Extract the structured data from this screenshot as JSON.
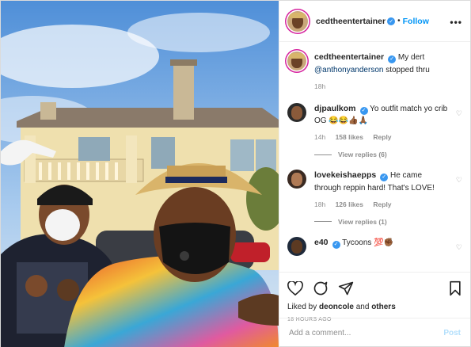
{
  "header": {
    "username": "cedtheentertainer",
    "separator": "•",
    "follow_label": "Follow",
    "more_label": "•••"
  },
  "caption": {
    "username": "cedtheentertainer",
    "text_before": "My dert",
    "mention": "@anthonyanderson",
    "text_after": "stopped thru",
    "time": "18h"
  },
  "comments": [
    {
      "username": "djpaulkom",
      "text": "Yo outfit match yo crib OG 😂😂👍🏾🙏🏾",
      "time": "14h",
      "likes": "158 likes",
      "reply_label": "Reply",
      "view_replies": "View replies (6)"
    },
    {
      "username": "lovekeishaepps",
      "text": "He came through reppin hard! That's LOVE!",
      "time": "18h",
      "likes": "126 likes",
      "reply_label": "Reply",
      "view_replies": "View replies (1)"
    },
    {
      "username": "e40",
      "text": "Tycoons 💯✊🏾",
      "time": "",
      "likes": "",
      "reply_label": "",
      "view_replies": ""
    }
  ],
  "actions": {
    "liked_prefix": "Liked by",
    "liked_user": "deoncole",
    "liked_and": "and",
    "liked_others": "others",
    "timestamp": "18 HOURS AGO"
  },
  "add_comment": {
    "placeholder": "Add a comment...",
    "post_label": "Post"
  },
  "icons": {
    "like": "heart-icon",
    "comment": "comment-icon",
    "share": "share-icon",
    "save": "bookmark-icon",
    "verified": "verified-badge-icon",
    "comment_like": "small-heart-icon"
  },
  "colors": {
    "accent": "#0095f6",
    "verified": "#3897f0",
    "muted": "#8e8e8e",
    "post_disabled": "#b2dffc"
  }
}
